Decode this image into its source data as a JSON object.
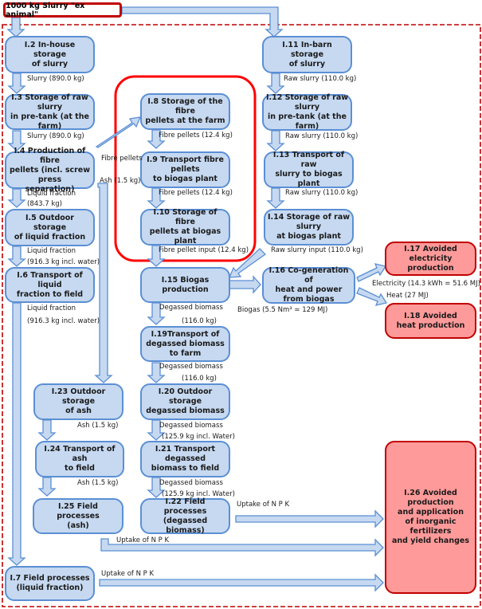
{
  "diagram": {
    "start": "1000 kg Slurry \"ex animal\"",
    "colors": {
      "process_fill": "#c6d9f1",
      "process_border": "#5b8fd4",
      "avoided_fill": "#ff9a9a",
      "avoided_border": "#c00000",
      "boundary": "#c00000",
      "highlight": "#ff0000"
    },
    "nodes": {
      "n1_2": "I.2 In-house storage\nof slurry",
      "n1_3": "I.3 Storage of raw slurry\nin pre-tank (at the farm)",
      "n1_4": "I.4 Production of fibre\npellets (incl. screw press\nseparation)",
      "n1_5": "I.5 Outdoor storage\nof liquid fraction",
      "n1_6": "I.6 Transport of liquid\nfraction to field",
      "n1_7": "I.7 Field processes\n(liquid fraction)",
      "n1_8": "I.8 Storage of the fibre\npellets at the farm",
      "n1_9": "I.9 Transport fibre pellets\nto biogas plant",
      "n1_10": "I.10 Storage of fibre\npellets at biogas plant",
      "n1_11": "I.11 In-barn storage\nof slurry",
      "n1_12": "I.12 Storage of raw slurry\nin pre-tank (at the farm)",
      "n1_13": "I.13 Transport of raw\nslurry to biogas plant",
      "n1_14": "I.14 Storage of raw slurry\nat biogas plant",
      "n1_15": "I.15 Biogas production",
      "n1_16": "I.16 Co-generation of\nheat and power\nfrom biogas",
      "n1_17": "I.17 Avoided\nelectricity production",
      "n1_18": "I.18 Avoided\nheat production",
      "n1_19": "I.19Transport of\ndegassed biomass\nto farm",
      "n1_20": "I.20 Outdoor storage\ndegassed biomass",
      "n1_21": "I.21 Transport degassed\nbiomass to field",
      "n1_22": "I.22 Field processes\n(degassed biomass)",
      "n1_23": "I.23 Outdoor storage\nof ash",
      "n1_24": "I.24 Transport of ash\nto field",
      "n1_25": "I.25 Field processes\n(ash)",
      "n1_26": "I.26 Avoided\nproduction\nand application\nof inorganic fertilizers\nand yield changes"
    },
    "flows": {
      "f_slurry_1": "Slurry (890.0 kg)",
      "f_slurry_2": "Slurry (890.0 kg)",
      "f_liquid_1a": "Liquid fraction",
      "f_liquid_1b": "(843.7 kg)",
      "f_liquid_2a": "Liquid fraction",
      "f_liquid_2b": "(916.3 kg incl. water)",
      "f_liquid_3a": "Liquid fraction",
      "f_liquid_3b": "(916.3 kg incl. water)",
      "f_fibre_pellets": "Fibre pellets",
      "f_ash_main": "Ash (1.5 kg)",
      "f_fibre_1": "Fibre pellets (12.4 kg)",
      "f_fibre_2": "Fibre pellets (12.4 kg)",
      "f_fibre_input": "Fibre pellet input (12.4 kg)",
      "f_raw_1": "Raw slurry (110.0 kg)",
      "f_raw_2": "Raw slurry (110.0 kg)",
      "f_raw_3": "Raw slurry (110.0 kg)",
      "f_raw_input": "Raw slurry input (110.0 kg)",
      "f_biogas": "Biogas (5.5 Nm³ = 129 MJ)",
      "f_electricity": "Electricity (14.3 kWh = 51.6 MJ)",
      "f_heat": "Heat (27 MJ)",
      "f_degassed_1a": "Degassed biomass",
      "f_degassed_1b": "(116.0 kg)",
      "f_degassed_2a": "Degassed biomass",
      "f_degassed_2b": "(116.0 kg)",
      "f_degassed_3a": "Degassed biomass",
      "f_degassed_3b": "(125.9 kg incl. Water)",
      "f_degassed_4a": "Degassed biomass",
      "f_degassed_4b": "(125.9 kg incl. Water)",
      "f_ash_1": "Ash (1.5 kg)",
      "f_ash_2": "Ash (1.5 kg)",
      "f_npk_1": "Uptake of N P K",
      "f_npk_2": "Uptake of N P K",
      "f_npk_3": "Uptake of N P K"
    }
  }
}
